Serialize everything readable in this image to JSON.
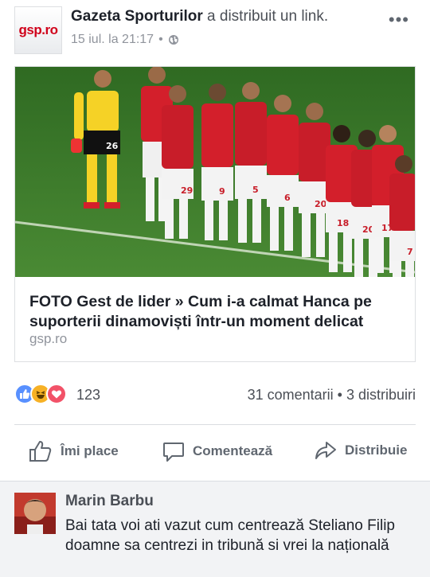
{
  "post": {
    "page_avatar_text": "gsp.ro",
    "page_name": "Gazeta Sporturilor",
    "action_text": " a distribuit un link.",
    "timestamp": "15 iul. la 21:17",
    "privacy_icon": "globe-icon",
    "more_icon": "more-icon"
  },
  "link": {
    "title": "FOTO Gest de lider » Cum i-a calmat Hanca pe suporterii dinamoviști într-un moment delicat",
    "domain": "gsp.ro",
    "image_description_icon": "football-team-photo",
    "jersey_numbers": [
      "26",
      "29",
      "9",
      "5",
      "6",
      "20",
      "18",
      "20",
      "17",
      "7"
    ]
  },
  "reactions": {
    "types": [
      "like",
      "haha",
      "love"
    ],
    "count": "123",
    "comments_shares": "31 comentarii • 3 distribuiri"
  },
  "actions": {
    "like_label": "Îmi place",
    "comment_label": "Comentează",
    "share_label": "Distribuie"
  },
  "comment": {
    "author": "Marin Barbu",
    "text": "Bai tata voi ati vazut cum centrează Steliano Filip doamne sa centrezi in tribună si vrei la națională"
  },
  "colors": {
    "accent": "#5890ff",
    "text_primary": "#1d2129",
    "text_secondary": "#90949c",
    "jersey_red": "#d31f2b",
    "goalkeeper_yellow": "#f5d226",
    "pitch_green": "#3e7a2c"
  }
}
